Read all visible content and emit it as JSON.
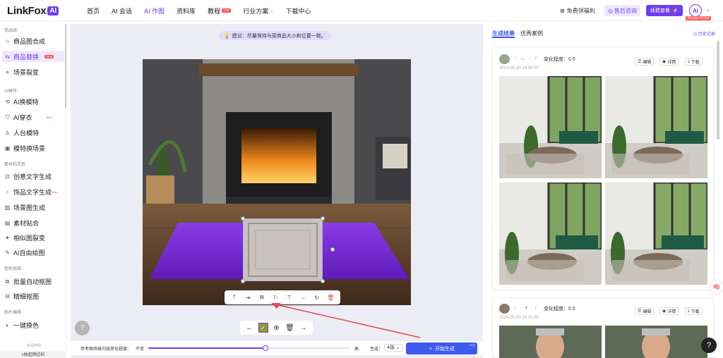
{
  "app": {
    "logo_text": "LinkFox",
    "logo_badge": "AI"
  },
  "nav": [
    {
      "label": "首页"
    },
    {
      "label": "AI 会话"
    },
    {
      "label": "AI 作图",
      "active": true
    },
    {
      "label": "资料库"
    },
    {
      "label": "教程",
      "badge": "NEW"
    },
    {
      "label": "行业方案",
      "dropdown": true
    },
    {
      "label": "下载中心"
    }
  ],
  "topright": {
    "gift_label": "免费领福利",
    "support_label": "售后咨询",
    "upgrade_label": "续费套餐",
    "avatar_text": "AI",
    "avatar_tag": "请完善账号免登录"
  },
  "sidebar": {
    "sections": [
      {
        "title": "商品图",
        "items": [
          {
            "label": "商品图合成",
            "icon": "home-icon"
          },
          {
            "label": "商品替换",
            "icon": "swap-icon",
            "active": true,
            "badge": "NEW"
          },
          {
            "label": "场景裂变",
            "icon": "split-icon"
          }
        ]
      },
      {
        "title": "AI模特",
        "items": [
          {
            "label": "AI换模特",
            "icon": "person-swap-icon"
          },
          {
            "label": "AI穿衣",
            "icon": "shirt-icon",
            "badge": "Beta"
          },
          {
            "label": "人台模特",
            "icon": "mannequin-icon"
          },
          {
            "label": "模特换场景",
            "icon": "scene-icon"
          }
        ]
      },
      {
        "title": "素材和灵感",
        "items": [
          {
            "label": "创意文字生成",
            "icon": "text-icon"
          },
          {
            "label": "饰品文字生成",
            "icon": "ornament-text-icon",
            "badge": "Beta"
          },
          {
            "label": "场景图生成",
            "icon": "image-icon"
          },
          {
            "label": "素材贴合",
            "icon": "layer-icon"
          },
          {
            "label": "相似图裂变",
            "icon": "similar-icon"
          },
          {
            "label": "AI自由绘图",
            "icon": "draw-icon"
          }
        ]
      },
      {
        "title": "智能抠图",
        "items": [
          {
            "label": "批量自动抠图",
            "icon": "batch-cut-icon"
          },
          {
            "label": "精细抠图",
            "icon": "fine-cut-icon"
          }
        ]
      },
      {
        "title": "图片编辑",
        "items": [
          {
            "label": "一键换色",
            "icon": "color-icon"
          }
        ]
      }
    ],
    "footer_label": "«收起侧边栏",
    "footer_note": "免责声明"
  },
  "canvas": {
    "tip": "建议：尽量保持与原商品大小和位置一致。",
    "toolbar_icons": [
      "upload-icon",
      "import-icon",
      "replace-icon",
      "flag-icon",
      "align-icon",
      "flip-icon",
      "rotate-icon",
      "delete-icon"
    ],
    "nav_icons": [
      "arrow-left-icon",
      "confirm-icon",
      "add-icon",
      "trash-icon",
      "arrow-right-icon"
    ]
  },
  "bottom": {
    "ref_label": "参考图场景内容变化程度：",
    "no_change": "不变",
    "high": "高",
    "slider_value": 0.58,
    "gen_label": "生成：",
    "gen_count": "4张",
    "start_label": "开始生成",
    "cost": "40点"
  },
  "right": {
    "tabs": [
      {
        "label": "生成结果",
        "active": true
      },
      {
        "label": "优秀案例"
      }
    ],
    "history_label": "历史记录",
    "cards": [
      {
        "change": "变化程度：0.5",
        "date": "2024-05-30 14:56:09",
        "edit": "编辑",
        "detail": "详情",
        "download": "下载"
      },
      {
        "change": "变化程度：0.5",
        "date": "2024-05-30 14:41:38",
        "edit": "编辑",
        "detail": "详情",
        "download": "下载"
      }
    ]
  },
  "colors": {
    "accent": "#6d3df0",
    "blue": "#3d5af1",
    "rug": "#7b2fd6"
  }
}
